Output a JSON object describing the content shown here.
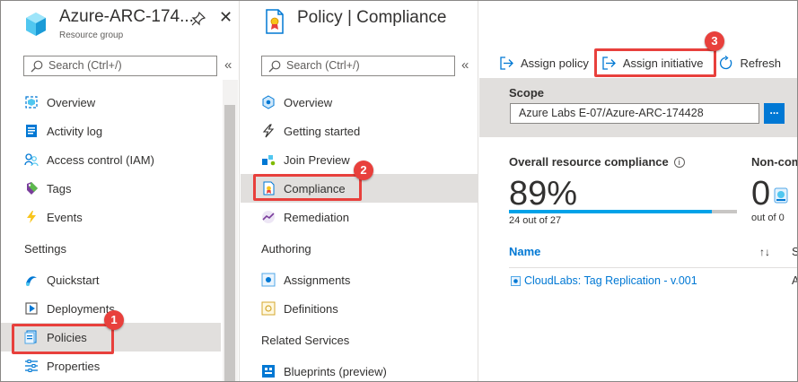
{
  "left_blade": {
    "title": "Azure-ARC-174...",
    "subtitle": "Resource group",
    "search_placeholder": "Search (Ctrl+/)",
    "collapse": "«",
    "items": [
      {
        "label": "Overview",
        "icon": "resource-group-icon"
      },
      {
        "label": "Activity log",
        "icon": "activity-log-icon"
      },
      {
        "label": "Access control (IAM)",
        "icon": "people-icon"
      },
      {
        "label": "Tags",
        "icon": "tag-icon"
      },
      {
        "label": "Events",
        "icon": "lightning-icon"
      }
    ],
    "settings_header": "Settings",
    "settings_items": [
      {
        "label": "Quickstart",
        "icon": "quickstart-icon"
      },
      {
        "label": "Deployments",
        "icon": "deployments-icon"
      },
      {
        "label": "Policies",
        "icon": "policies-icon",
        "selected": true
      },
      {
        "label": "Properties",
        "icon": "properties-icon"
      }
    ]
  },
  "mid_blade": {
    "title": "Policy | Compliance",
    "search_placeholder": "Search (Ctrl+/)",
    "collapse": "«",
    "items": [
      {
        "label": "Overview",
        "icon": "overview-icon"
      },
      {
        "label": "Getting started",
        "icon": "getting-started-icon"
      },
      {
        "label": "Join Preview",
        "icon": "join-preview-icon"
      },
      {
        "label": "Compliance",
        "icon": "compliance-icon",
        "selected": true
      },
      {
        "label": "Remediation",
        "icon": "remediation-icon"
      }
    ],
    "authoring_header": "Authoring",
    "authoring_items": [
      {
        "label": "Assignments",
        "icon": "assignments-icon"
      },
      {
        "label": "Definitions",
        "icon": "definitions-icon"
      }
    ],
    "related_header": "Related Services",
    "related_items": [
      {
        "label": "Blueprints (preview)",
        "icon": "blueprints-icon"
      }
    ]
  },
  "toolbar": {
    "assign_policy": "Assign policy",
    "assign_initiative": "Assign initiative",
    "refresh": "Refresh"
  },
  "scope": {
    "label": "Scope",
    "value": "Azure Labs E-07/Azure-ARC-174428",
    "button": "..."
  },
  "compliance": {
    "overall_label": "Overall resource compliance",
    "overall_value": "89%",
    "overall_fraction": 0.89,
    "overall_sub": "24 out of 27",
    "noncompliant_label": "Non-com",
    "noncompliant_value": "0",
    "noncompliant_sub": "out of 0"
  },
  "table": {
    "col_name": "Name",
    "col_s": "S",
    "sort_glyph": "↑↓",
    "rows": [
      {
        "name": "CloudLabs: Tag Replication - v.001",
        "status": "A"
      }
    ]
  },
  "annotations": {
    "badge1": "1",
    "badge2": "2",
    "badge3": "3",
    "color": "#e8403c"
  },
  "colors": {
    "accent": "#0078d4",
    "progress": "#00a2e8",
    "selected_bg": "#e1dfdd"
  }
}
